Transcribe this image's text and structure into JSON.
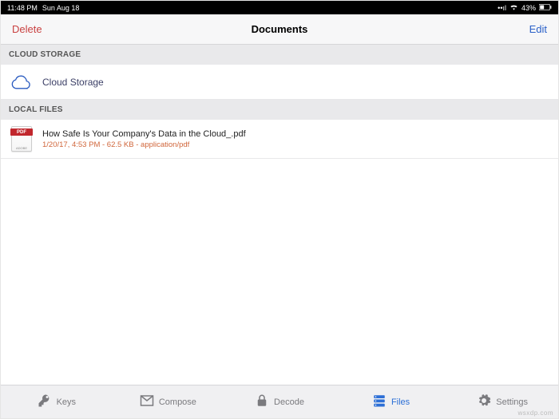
{
  "status": {
    "time": "11:48 PM",
    "date": "Sun Aug 18",
    "battery": "43%"
  },
  "nav": {
    "left": "Delete",
    "title": "Documents",
    "right": "Edit"
  },
  "sections": {
    "cloud": {
      "header": "CLOUD STORAGE",
      "item_label": "Cloud Storage"
    },
    "local": {
      "header": "LOCAL FILES",
      "file": {
        "name": "How Safe Is Your Company's Data in the Cloud_.pdf",
        "meta": "1/20/17, 4:53 PM - 62.5 KB - application/pdf",
        "badge": "PDF"
      }
    }
  },
  "tabs": {
    "keys": "Keys",
    "compose": "Compose",
    "decode": "Decode",
    "files": "Files",
    "settings": "Settings"
  },
  "watermark": "wsxdp.com"
}
